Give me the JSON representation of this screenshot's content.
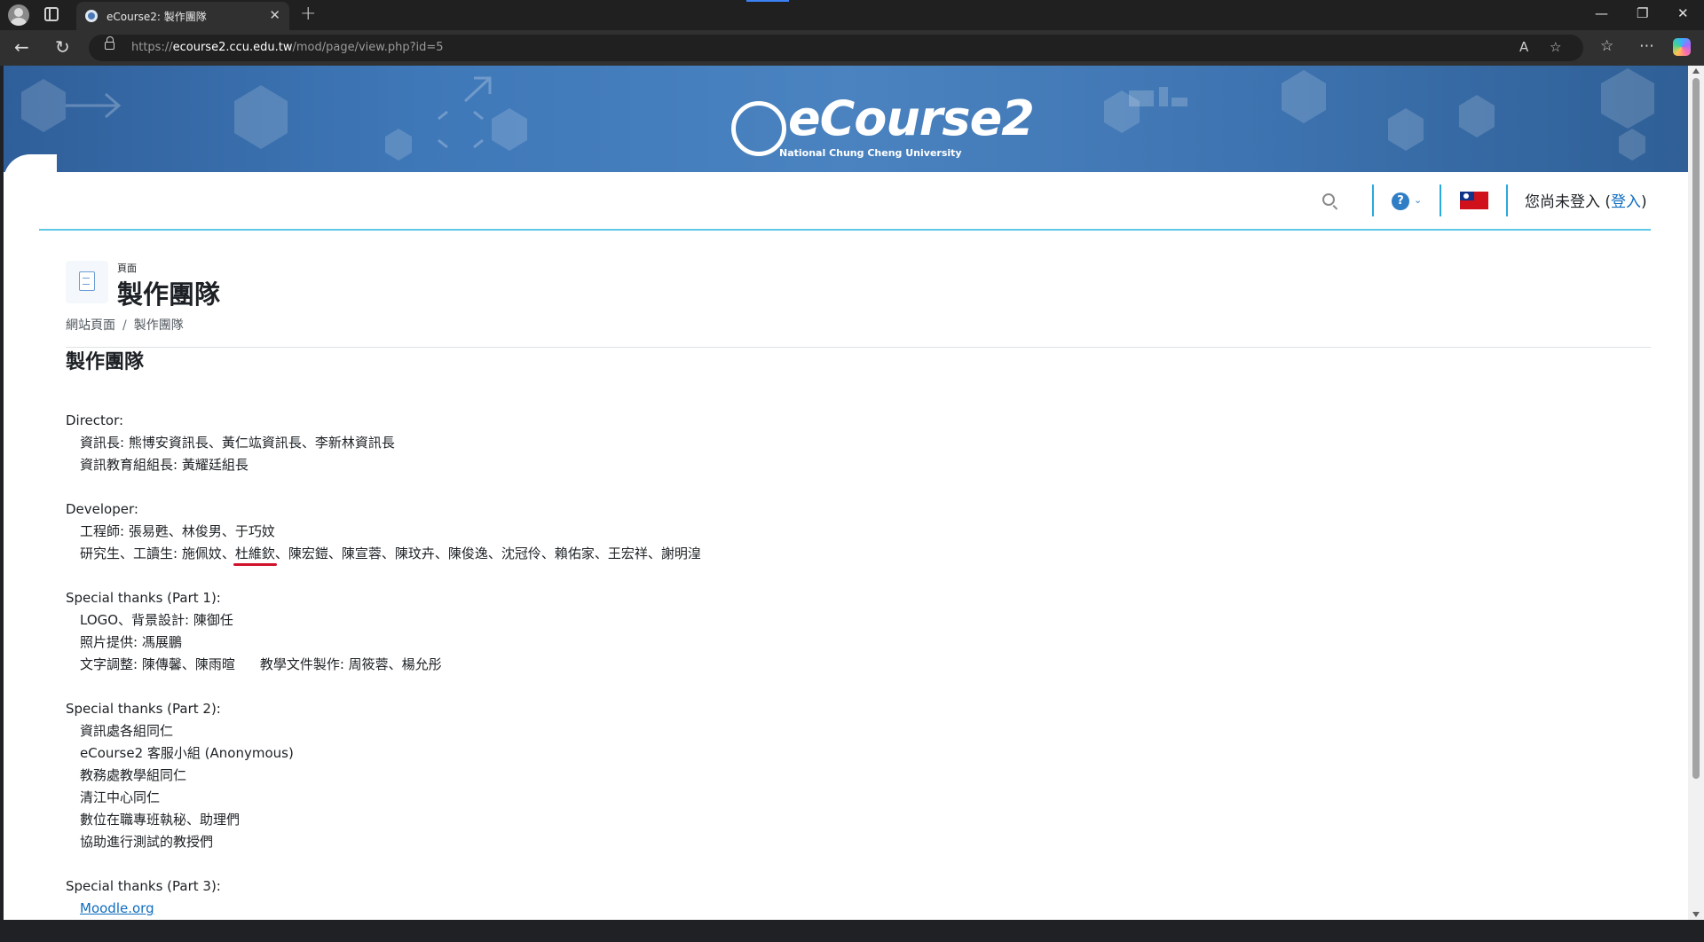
{
  "browser": {
    "tab_title": "eCourse2: 製作團隊",
    "url_scheme": "https://",
    "url_host": "ecourse2.ccu.edu.tw",
    "url_path": "/mod/page/view.php?id=5"
  },
  "site": {
    "logo_text": "eCourse2",
    "logo_subtitle": "National Chung Cheng University"
  },
  "header": {
    "login_prefix": "您尚未登入 (",
    "login_link": "登入",
    "login_suffix": ")"
  },
  "page": {
    "kind_label": "頁面",
    "title": "製作團隊",
    "breadcrumb": [
      "網站頁面",
      "製作團隊"
    ],
    "heading": "製作團隊"
  },
  "content": {
    "director": {
      "label": "Director:",
      "lines": [
        "資訊長: 熊博安資訊長、黃仁竑資訊長、李新林資訊長",
        "資訊教育組組長: 黃耀廷組長"
      ]
    },
    "developer": {
      "label": "Developer:",
      "line1": "工程師: 張易甦、林俊男、于巧妏",
      "line2_before": "研究生、工讀生: 施佩妏、",
      "line2_highlight": "杜維欽",
      "line2_after": "、陳宏鎧、陳宣蓉、陳玟卉、陳俊逸、沈冠伶、賴佑家、王宏祥、謝明湟"
    },
    "thanks1": {
      "label": "Special thanks (Part 1):",
      "line1": "LOGO、背景設計: 陳御任",
      "line2": "照片提供: 馮展鵬",
      "line3a": "文字調整: 陳傳馨、陳雨暄",
      "line3b": "教學文件製作: 周筱蓉、楊允彤"
    },
    "thanks2": {
      "label": "Special thanks (Part 2):",
      "lines": [
        "資訊處各組同仁",
        "eCourse2 客服小組 (Anonymous)",
        "教務處教學組同仁",
        "清江中心同仁",
        "數位在職專班執秘、助理們",
        "協助進行測試的教授們"
      ]
    },
    "thanks3": {
      "label": "Special thanks (Part 3):",
      "link": "Moodle.org"
    }
  }
}
